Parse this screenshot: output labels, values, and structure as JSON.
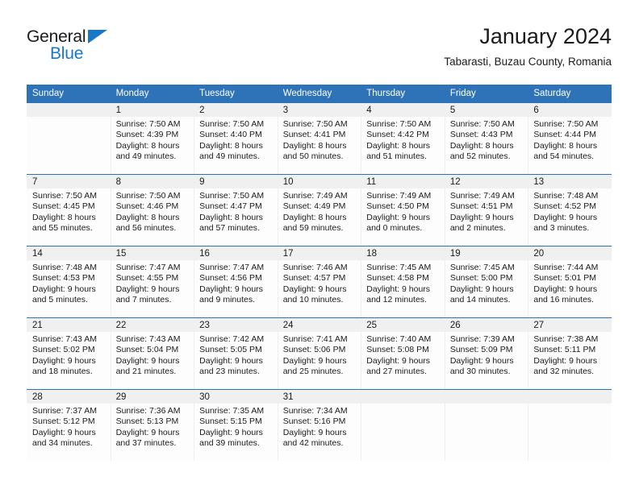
{
  "logo": {
    "word1": "General",
    "word2": "Blue",
    "triangle_color": "#1878c8"
  },
  "header": {
    "title": "January 2024",
    "subtitle": "Tabarasti, Buzau County, Romania"
  },
  "colors": {
    "header_band": "#2e73b8",
    "daynum_band": "#f0f0f0",
    "row_rule": "#2e73b8",
    "text": "#1b1b1b"
  },
  "calendar": {
    "weekday_headers": [
      "Sunday",
      "Monday",
      "Tuesday",
      "Wednesday",
      "Thursday",
      "Friday",
      "Saturday"
    ],
    "weeks": [
      [
        {
          "day": "",
          "lines": []
        },
        {
          "day": "1",
          "lines": [
            "Sunrise: 7:50 AM",
            "Sunset: 4:39 PM",
            "Daylight: 8 hours",
            "and 49 minutes."
          ]
        },
        {
          "day": "2",
          "lines": [
            "Sunrise: 7:50 AM",
            "Sunset: 4:40 PM",
            "Daylight: 8 hours",
            "and 49 minutes."
          ]
        },
        {
          "day": "3",
          "lines": [
            "Sunrise: 7:50 AM",
            "Sunset: 4:41 PM",
            "Daylight: 8 hours",
            "and 50 minutes."
          ]
        },
        {
          "day": "4",
          "lines": [
            "Sunrise: 7:50 AM",
            "Sunset: 4:42 PM",
            "Daylight: 8 hours",
            "and 51 minutes."
          ]
        },
        {
          "day": "5",
          "lines": [
            "Sunrise: 7:50 AM",
            "Sunset: 4:43 PM",
            "Daylight: 8 hours",
            "and 52 minutes."
          ]
        },
        {
          "day": "6",
          "lines": [
            "Sunrise: 7:50 AM",
            "Sunset: 4:44 PM",
            "Daylight: 8 hours",
            "and 54 minutes."
          ]
        }
      ],
      [
        {
          "day": "7",
          "lines": [
            "Sunrise: 7:50 AM",
            "Sunset: 4:45 PM",
            "Daylight: 8 hours",
            "and 55 minutes."
          ]
        },
        {
          "day": "8",
          "lines": [
            "Sunrise: 7:50 AM",
            "Sunset: 4:46 PM",
            "Daylight: 8 hours",
            "and 56 minutes."
          ]
        },
        {
          "day": "9",
          "lines": [
            "Sunrise: 7:50 AM",
            "Sunset: 4:47 PM",
            "Daylight: 8 hours",
            "and 57 minutes."
          ]
        },
        {
          "day": "10",
          "lines": [
            "Sunrise: 7:49 AM",
            "Sunset: 4:49 PM",
            "Daylight: 8 hours",
            "and 59 minutes."
          ]
        },
        {
          "day": "11",
          "lines": [
            "Sunrise: 7:49 AM",
            "Sunset: 4:50 PM",
            "Daylight: 9 hours",
            "and 0 minutes."
          ]
        },
        {
          "day": "12",
          "lines": [
            "Sunrise: 7:49 AM",
            "Sunset: 4:51 PM",
            "Daylight: 9 hours",
            "and 2 minutes."
          ]
        },
        {
          "day": "13",
          "lines": [
            "Sunrise: 7:48 AM",
            "Sunset: 4:52 PM",
            "Daylight: 9 hours",
            "and 3 minutes."
          ]
        }
      ],
      [
        {
          "day": "14",
          "lines": [
            "Sunrise: 7:48 AM",
            "Sunset: 4:53 PM",
            "Daylight: 9 hours",
            "and 5 minutes."
          ]
        },
        {
          "day": "15",
          "lines": [
            "Sunrise: 7:47 AM",
            "Sunset: 4:55 PM",
            "Daylight: 9 hours",
            "and 7 minutes."
          ]
        },
        {
          "day": "16",
          "lines": [
            "Sunrise: 7:47 AM",
            "Sunset: 4:56 PM",
            "Daylight: 9 hours",
            "and 9 minutes."
          ]
        },
        {
          "day": "17",
          "lines": [
            "Sunrise: 7:46 AM",
            "Sunset: 4:57 PM",
            "Daylight: 9 hours",
            "and 10 minutes."
          ]
        },
        {
          "day": "18",
          "lines": [
            "Sunrise: 7:45 AM",
            "Sunset: 4:58 PM",
            "Daylight: 9 hours",
            "and 12 minutes."
          ]
        },
        {
          "day": "19",
          "lines": [
            "Sunrise: 7:45 AM",
            "Sunset: 5:00 PM",
            "Daylight: 9 hours",
            "and 14 minutes."
          ]
        },
        {
          "day": "20",
          "lines": [
            "Sunrise: 7:44 AM",
            "Sunset: 5:01 PM",
            "Daylight: 9 hours",
            "and 16 minutes."
          ]
        }
      ],
      [
        {
          "day": "21",
          "lines": [
            "Sunrise: 7:43 AM",
            "Sunset: 5:02 PM",
            "Daylight: 9 hours",
            "and 18 minutes."
          ]
        },
        {
          "day": "22",
          "lines": [
            "Sunrise: 7:43 AM",
            "Sunset: 5:04 PM",
            "Daylight: 9 hours",
            "and 21 minutes."
          ]
        },
        {
          "day": "23",
          "lines": [
            "Sunrise: 7:42 AM",
            "Sunset: 5:05 PM",
            "Daylight: 9 hours",
            "and 23 minutes."
          ]
        },
        {
          "day": "24",
          "lines": [
            "Sunrise: 7:41 AM",
            "Sunset: 5:06 PM",
            "Daylight: 9 hours",
            "and 25 minutes."
          ]
        },
        {
          "day": "25",
          "lines": [
            "Sunrise: 7:40 AM",
            "Sunset: 5:08 PM",
            "Daylight: 9 hours",
            "and 27 minutes."
          ]
        },
        {
          "day": "26",
          "lines": [
            "Sunrise: 7:39 AM",
            "Sunset: 5:09 PM",
            "Daylight: 9 hours",
            "and 30 minutes."
          ]
        },
        {
          "day": "27",
          "lines": [
            "Sunrise: 7:38 AM",
            "Sunset: 5:11 PM",
            "Daylight: 9 hours",
            "and 32 minutes."
          ]
        }
      ],
      [
        {
          "day": "28",
          "lines": [
            "Sunrise: 7:37 AM",
            "Sunset: 5:12 PM",
            "Daylight: 9 hours",
            "and 34 minutes."
          ]
        },
        {
          "day": "29",
          "lines": [
            "Sunrise: 7:36 AM",
            "Sunset: 5:13 PM",
            "Daylight: 9 hours",
            "and 37 minutes."
          ]
        },
        {
          "day": "30",
          "lines": [
            "Sunrise: 7:35 AM",
            "Sunset: 5:15 PM",
            "Daylight: 9 hours",
            "and 39 minutes."
          ]
        },
        {
          "day": "31",
          "lines": [
            "Sunrise: 7:34 AM",
            "Sunset: 5:16 PM",
            "Daylight: 9 hours",
            "and 42 minutes."
          ]
        },
        {
          "day": "",
          "lines": []
        },
        {
          "day": "",
          "lines": []
        },
        {
          "day": "",
          "lines": []
        }
      ]
    ]
  }
}
